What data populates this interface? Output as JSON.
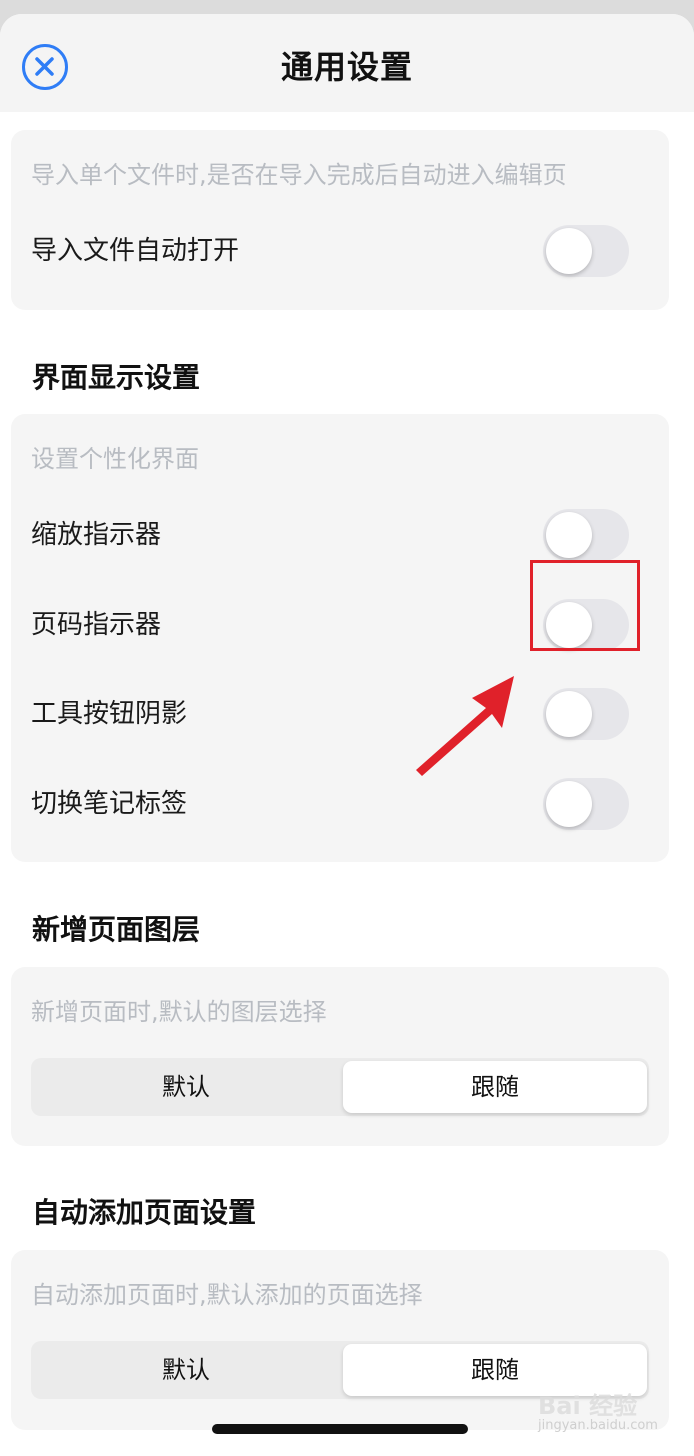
{
  "header": {
    "title": "通用设置",
    "close_icon": "close-circle-icon",
    "accent_color": "#2f7df6"
  },
  "import_card": {
    "description": "导入单个文件时,是否在导入完成后自动进入编辑页",
    "toggle_label": "导入文件自动打开",
    "toggle_on": false
  },
  "display_section": {
    "title": "界面显示设置",
    "description": "设置个性化界面",
    "items": [
      {
        "label": "缩放指示器",
        "on": false
      },
      {
        "label": "页码指示器",
        "on": false
      },
      {
        "label": "工具按钮阴影",
        "on": false
      },
      {
        "label": "切换笔记标签",
        "on": false
      }
    ]
  },
  "new_page_layer": {
    "title": "新增页面图层",
    "description": "新增页面时,默认的图层选择",
    "options": [
      "默认",
      "跟随"
    ],
    "selected": "跟随"
  },
  "auto_add_page": {
    "title": "自动添加页面设置",
    "description": "自动添加页面时,默认添加的页面选择",
    "options": [
      "默认",
      "跟随"
    ],
    "selected": "跟随"
  },
  "annotation": {
    "highlight_color": "#e0212a",
    "arrow_icon": "arrow-up-right-icon"
  },
  "watermark": {
    "text": "Bai 经验",
    "url": "jingyan.baidu.com"
  }
}
